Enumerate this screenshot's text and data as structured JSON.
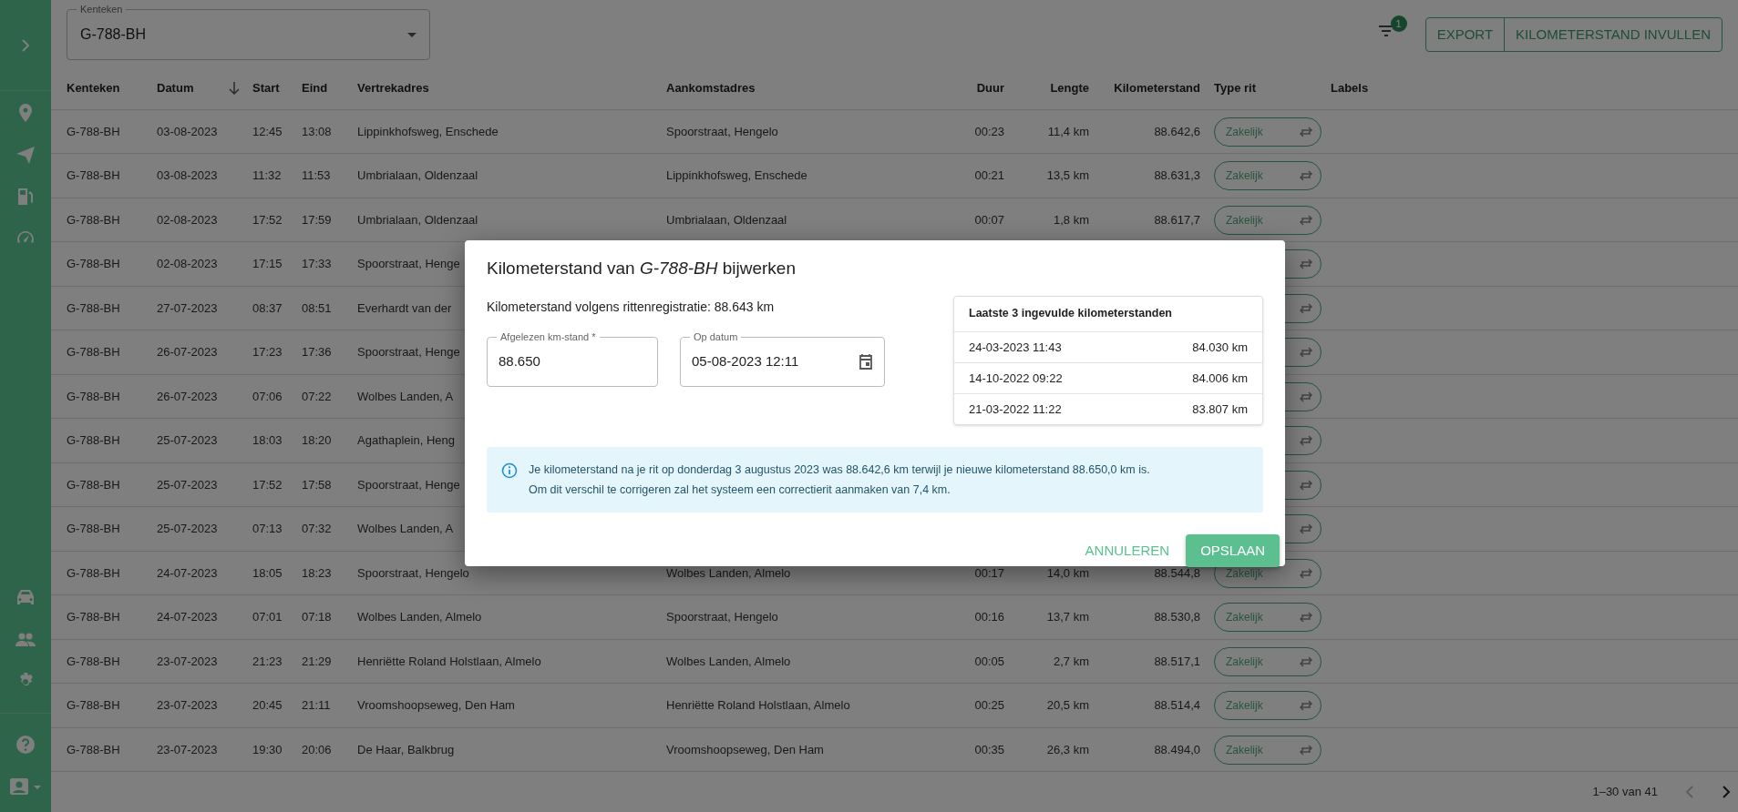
{
  "plate_select": {
    "label": "Kenteken",
    "value": "G-788-BH"
  },
  "filter": {
    "badge": "1"
  },
  "actions": [
    {
      "label": "EXPORT"
    },
    {
      "label": "KILOMETERSTAND INVULLEN"
    }
  ],
  "table": {
    "columns": [
      {
        "label": "Kenteken",
        "sorted": false
      },
      {
        "label": "Datum",
        "sorted": true
      },
      {
        "label": "Start",
        "sorted": false
      },
      {
        "label": "Eind",
        "sorted": false
      },
      {
        "label": "Vertrekadres",
        "sorted": false
      },
      {
        "label": "Aankomstadres",
        "sorted": false
      },
      {
        "label": "Duur",
        "sorted": false
      },
      {
        "label": "Lengte",
        "sorted": false
      },
      {
        "label": "Kilometerstand",
        "sorted": false
      },
      {
        "label": "Type rit",
        "sorted": false
      },
      {
        "label": "Labels",
        "sorted": false
      }
    ],
    "rows": [
      {
        "plate": "G-788-BH",
        "date": "03-08-2023",
        "start": "12:45",
        "end": "13:08",
        "from": "Lippinkhofsweg, Enschede",
        "to": "Spoorstraat, Hengelo",
        "duration": "00:23",
        "length": "11,4 km",
        "odometer": "88.642,6",
        "trip_type": "Zakelijk"
      },
      {
        "plate": "G-788-BH",
        "date": "03-08-2023",
        "start": "11:32",
        "end": "11:53",
        "from": "Umbrialaan, Oldenzaal",
        "to": "Lippinkhofsweg, Enschede",
        "duration": "00:21",
        "length": "13,5 km",
        "odometer": "88.631,3",
        "trip_type": "Zakelijk"
      },
      {
        "plate": "G-788-BH",
        "date": "02-08-2023",
        "start": "17:52",
        "end": "17:59",
        "from": "Umbrialaan, Oldenzaal",
        "to": "Umbrialaan, Oldenzaal",
        "duration": "00:07",
        "length": "1,8 km",
        "odometer": "88.617,7",
        "trip_type": "Zakelijk"
      },
      {
        "plate": "G-788-BH",
        "date": "02-08-2023",
        "start": "17:15",
        "end": "17:33",
        "from": "Spoorstraat, Henge"
      },
      {
        "plate": "G-788-BH",
        "date": "27-07-2023",
        "start": "08:37",
        "end": "08:51",
        "from": "Everhardt van der"
      },
      {
        "plate": "G-788-BH",
        "date": "26-07-2023",
        "start": "17:23",
        "end": "17:36",
        "from": "Spoorstraat, Henge"
      },
      {
        "plate": "G-788-BH",
        "date": "26-07-2023",
        "start": "07:06",
        "end": "07:22",
        "from": "Wolbes Landen, A"
      },
      {
        "plate": "G-788-BH",
        "date": "25-07-2023",
        "start": "18:03",
        "end": "18:20",
        "from": "Agathaplein, Heng"
      },
      {
        "plate": "G-788-BH",
        "date": "25-07-2023",
        "start": "17:52",
        "end": "17:58",
        "from": "Spoorstraat, Henge"
      },
      {
        "plate": "G-788-BH",
        "date": "25-07-2023",
        "start": "07:13",
        "end": "07:32",
        "from": "Wolbes Landen, A"
      },
      {
        "plate": "G-788-BH",
        "date": "24-07-2023",
        "start": "18:05",
        "end": "18:23",
        "from": "Spoorstraat, Hengelo",
        "to": "Wolbes Landen, Almelo",
        "duration": "00:17",
        "length": "14,0 km",
        "odometer": "88.544,8",
        "trip_type": "Zakelijk"
      },
      {
        "plate": "G-788-BH",
        "date": "24-07-2023",
        "start": "07:01",
        "end": "07:18",
        "from": "Wolbes Landen, Almelo",
        "to": "Spoorstraat, Hengelo",
        "duration": "00:16",
        "length": "13,7 km",
        "odometer": "88.530,8",
        "trip_type": "Zakelijk"
      },
      {
        "plate": "G-788-BH",
        "date": "23-07-2023",
        "start": "21:23",
        "end": "21:29",
        "from": "Henriëtte Roland Holstlaan, Almelo",
        "to": "Wolbes Landen, Almelo",
        "duration": "00:05",
        "length": "2,7 km",
        "odometer": "88.517,1",
        "trip_type": "Zakelijk"
      },
      {
        "plate": "G-788-BH",
        "date": "23-07-2023",
        "start": "20:45",
        "end": "21:11",
        "from": "Vroomshoopseweg, Den Ham",
        "to": "Henriëtte Roland Holstlaan, Almelo",
        "duration": "00:25",
        "length": "20,5 km",
        "odometer": "88.514,4",
        "trip_type": "Zakelijk"
      },
      {
        "plate": "G-788-BH",
        "date": "23-07-2023",
        "start": "19:30",
        "end": "20:06",
        "from": "De Haar, Balkbrug",
        "to": "Vroomshoopseweg, Den Ham",
        "duration": "00:35",
        "length": "26,3 km",
        "odometer": "88.494,0",
        "trip_type": "Zakelijk"
      }
    ]
  },
  "pagination": {
    "text": "1–30 van 41",
    "prev_disabled": true,
    "next_disabled": false
  },
  "modal": {
    "title": "Kilometerstand van *G-788-BH* bijwerken",
    "registration_text": "Kilometerstand volgens rittenregistratie: 88.643 km",
    "fields": [
      {
        "kind": "text",
        "label": "Afgelezen km-stand *",
        "value": "88.650"
      },
      {
        "kind": "date",
        "label": "Op datum",
        "value": "05-08-2023 12:11"
      }
    ],
    "recent": {
      "title": "Laatste 3 ingevulde kilometerstanden",
      "entries": [
        {
          "date": "24-03-2023 11:43",
          "km": "84.030 km"
        },
        {
          "date": "14-10-2022 09:22",
          "km": "84.006 km"
        },
        {
          "date": "21-03-2022 11:22",
          "km": "83.807 km"
        }
      ]
    },
    "alert": {
      "lines": [
        "Je kilometerstand na je rit op donderdag 3 augustus 2023 was 88.642,6 km terwijl je nieuwe kilometerstand 88.650,0 km is.",
        "Om dit verschil te corrigeren zal het systeem een correctierit aanmaken van 7,4 km."
      ]
    },
    "buttons": [
      {
        "kind": "text",
        "label": "ANNULEREN"
      },
      {
        "kind": "primary",
        "label": "OPSLAAN"
      }
    ]
  }
}
